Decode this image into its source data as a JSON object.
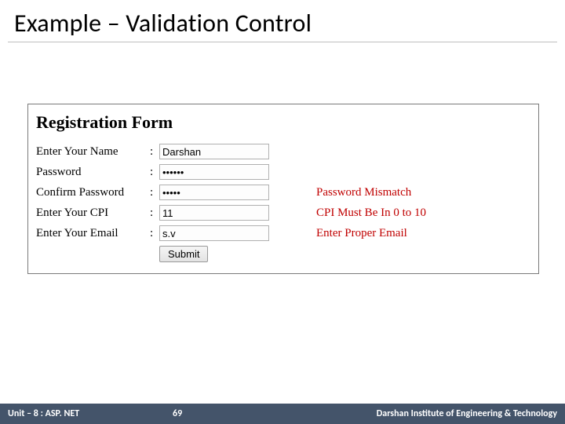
{
  "title": "Example – Validation Control",
  "form": {
    "heading": "Registration Form",
    "rows": [
      {
        "label": "Enter Your Name",
        "value": "Darshan",
        "type": "text",
        "error": ""
      },
      {
        "label": "Password",
        "value": "••••••",
        "type": "password",
        "error": ""
      },
      {
        "label": "Confirm Password",
        "value": "•••••",
        "type": "password",
        "error": "Password Mismatch"
      },
      {
        "label": "Enter Your CPI",
        "value": "11",
        "type": "text",
        "error": "CPI Must Be In 0 to 10"
      },
      {
        "label": "Enter Your Email",
        "value": "s.v",
        "type": "text",
        "error": "Enter Proper Email"
      }
    ],
    "submit_label": "Submit"
  },
  "footer": {
    "left": "Unit – 8 : ASP. NET",
    "page": "69",
    "right": "Darshan Institute of Engineering & Technology"
  }
}
